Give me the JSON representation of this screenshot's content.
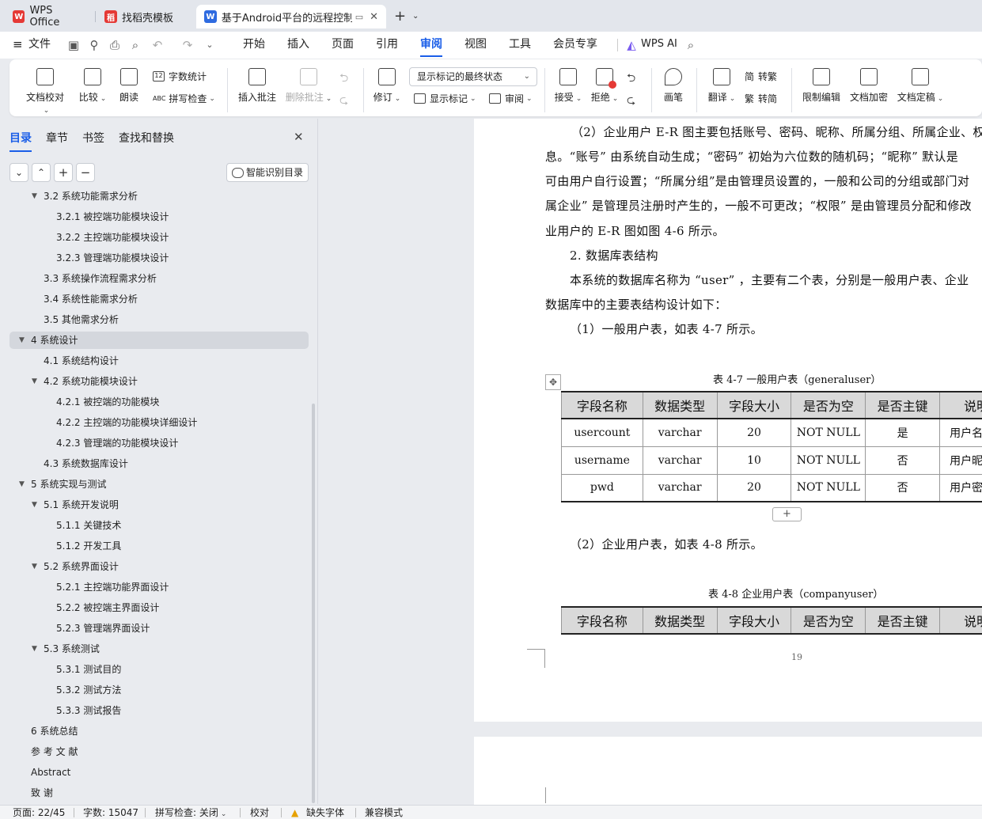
{
  "tabs": [
    {
      "label": "WPS Office",
      "icon": "wps-logo-icon",
      "color": "#e53935"
    },
    {
      "label": "找稻壳模板",
      "icon": "docer-logo-icon",
      "color": "#e53935"
    },
    {
      "label": "基于Android平台的远程控制",
      "icon": "writer-logo-icon",
      "color": "#2f6be0"
    }
  ],
  "menu": {
    "file": "文件",
    "items": [
      "开始",
      "插入",
      "页面",
      "引用",
      "审阅",
      "视图",
      "工具",
      "会员专享"
    ],
    "active": "审阅",
    "ai": "WPS AI"
  },
  "ribbon": {
    "doc_check": "文档校对",
    "compare": "比较",
    "read_aloud": "朗读",
    "word_count": "字数统计",
    "spell_check": "拼写检查",
    "insert_comment": "插入批注",
    "delete_comment": "删除批注",
    "revise": "修订",
    "markup_state": "显示标记的最终状态",
    "show_markup": "显示标记",
    "review": "审阅",
    "accept": "接受",
    "reject": "拒绝",
    "pen": "画笔",
    "translate": "翻译",
    "to_traditional": "转繁",
    "to_simplified": "转简",
    "restrict_edit": "限制编辑",
    "encrypt": "文档加密",
    "finalize": "文档定稿"
  },
  "panel": {
    "tabs": [
      "目录",
      "章节",
      "书签",
      "查找和替换"
    ],
    "ai_toc": "智能识别目录",
    "toc": [
      {
        "text": "3.2  系统功能需求分析",
        "level": 2,
        "expanded": true
      },
      {
        "text": "3.2.1  被控端功能模块设计",
        "level": 3
      },
      {
        "text": "3.2.2  主控端功能模块设计",
        "level": 3
      },
      {
        "text": "3.2.3  管理端功能模块设计",
        "level": 3
      },
      {
        "text": "3.3  系统操作流程需求分析",
        "level": 2
      },
      {
        "text": "3.4  系统性能需求分析",
        "level": 2
      },
      {
        "text": "3.5  其他需求分析",
        "level": 2
      },
      {
        "text": "4  系统设计",
        "level": 1,
        "expanded": true,
        "selected": true
      },
      {
        "text": "4.1  系统结构设计",
        "level": 2
      },
      {
        "text": "4.2  系统功能模块设计",
        "level": 2,
        "expanded": true
      },
      {
        "text": "4.2.1  被控端的功能模块",
        "level": 3
      },
      {
        "text": "4.2.2  主控端的功能模块详细设计",
        "level": 3
      },
      {
        "text": "4.2.3  管理端的功能模块设计",
        "level": 3
      },
      {
        "text": "4.3  系统数据库设计",
        "level": 2
      },
      {
        "text": "5  系统实现与测试",
        "level": 1,
        "expanded": true
      },
      {
        "text": "5.1  系统开发说明",
        "level": 2,
        "expanded": true
      },
      {
        "text": "5.1.1  关键技术",
        "level": 3
      },
      {
        "text": "5.1.2  开发工具",
        "level": 3
      },
      {
        "text": "5.2  系统界面设计",
        "level": 2,
        "expanded": true
      },
      {
        "text": "5.2.1  主控端功能界面设计",
        "level": 3
      },
      {
        "text": "5.2.2  被控端主界面设计",
        "level": 3
      },
      {
        "text": "5.2.3  管理端界面设计",
        "level": 3
      },
      {
        "text": "5.3  系统测试",
        "level": 2,
        "expanded": true
      },
      {
        "text": "5.3.1  测试目的",
        "level": 3
      },
      {
        "text": "5.3.2  测试方法",
        "level": 3
      },
      {
        "text": "5.3.3  测试报告",
        "level": 3
      },
      {
        "text": "6  系统总结",
        "level": 1
      },
      {
        "text": "参  考  文  献",
        "level": 1
      },
      {
        "text": "Abstract",
        "level": 1
      },
      {
        "text": "致      谢",
        "level": 1
      }
    ]
  },
  "document": {
    "paragraphs": [
      "（2）企业用户 E-R 图主要包括账号、密码、昵称、所属分组、所属企业、权",
      "息。“账号” 由系统自动生成；“密码” 初始为六位数的随机码；“昵称” 默认是",
      "可由用户自行设置；“所属分组”是由管理员设置的，一般和公司的分组或部门对",
      "属企业” 是管理员注册时产生的，一般不可更改；“权限” 是由管理员分配和修改",
      "业用户的 E-R 图如图 4-6 所示。",
      "2.  数据库表结构",
      "本系统的数据库名称为 “user” ，主要有二个表，分别是一般用户表、企业",
      "数据库中的主要表结构设计如下：",
      "（1）一般用户表，如表 4-7 所示。"
    ],
    "table1_caption": "表 4-7    一般用户表（generaluser）",
    "table_headers": [
      "字段名称",
      "数据类型",
      "字段大小",
      "是否为空",
      "是否主键",
      "说明"
    ],
    "table1_rows": [
      [
        "usercount",
        "varchar",
        "20",
        "NOT NULL",
        "是",
        "用户名"
      ],
      [
        "username",
        "varchar",
        "10",
        "NOT NULL",
        "否",
        "用户昵"
      ],
      [
        "pwd",
        "varchar",
        "20",
        "NOT NULL",
        "否",
        "用户密"
      ]
    ],
    "add_row": "+",
    "para_after": "（2）企业用户表，如表 4-8 所示。",
    "table2_caption": "表 4-8    企业用户表（companyuser）",
    "page_number": "19"
  },
  "status": {
    "page": "页面: 22/45",
    "words": "字数: 15047",
    "spell": "拼写检查: 关闭",
    "proof": "校对",
    "missing_font": "缺失字体",
    "compat": "兼容模式"
  }
}
